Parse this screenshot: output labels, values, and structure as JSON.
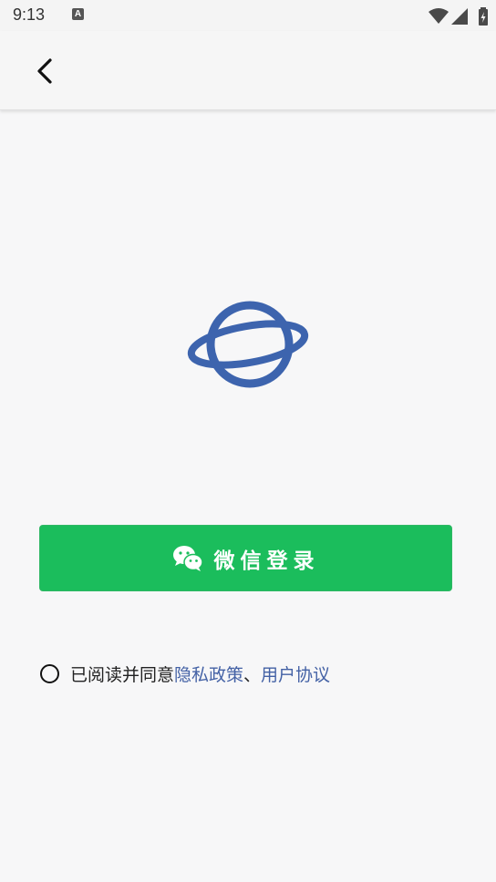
{
  "status_bar": {
    "time": "9:13",
    "notification_icon": "a-app-icon",
    "wifi_icon": "wifi-icon",
    "signal_icon": "cell-signal-icon",
    "battery_icon": "battery-charging-icon"
  },
  "app_bar": {
    "back_icon": "chevron-left-icon"
  },
  "logo": {
    "icon": "planet-icon",
    "color": "#3d64ae"
  },
  "login": {
    "wechat_label": "微信登录",
    "icon": "wechat-icon",
    "color": "#1bbd5c"
  },
  "agreement": {
    "prefix": "已阅读并同意",
    "privacy_link": "隐私政策",
    "separator": "、",
    "terms_link": "用户协议",
    "link_color": "#4361a5",
    "checked": false
  }
}
